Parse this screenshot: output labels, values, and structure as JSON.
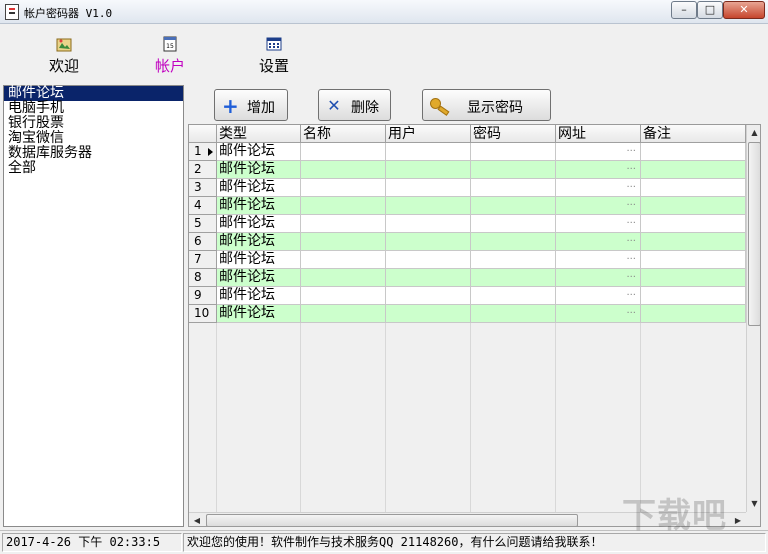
{
  "window": {
    "title": "帐户密码器 V1.0",
    "controls": {
      "minimize": "–",
      "maximize": "□",
      "close": "✕"
    }
  },
  "menu": [
    {
      "label": "欢迎",
      "icon": "welcome-icon"
    },
    {
      "label": "帐户",
      "icon": "calendar-icon"
    },
    {
      "label": "设置",
      "icon": "grid-icon"
    }
  ],
  "categories": [
    "邮件论坛",
    "电脑手机",
    "银行股票",
    "淘宝微信",
    "数据库服务器",
    "全部"
  ],
  "selected_category": "邮件论坛",
  "actions": {
    "add": "增加",
    "delete": "删除",
    "show_password": "显示密码"
  },
  "grid": {
    "columns": [
      "类型",
      "名称",
      "用户",
      "密码",
      "网址",
      "备注"
    ],
    "rows": [
      {
        "num": "1",
        "type": "邮件论坛"
      },
      {
        "num": "2",
        "type": "邮件论坛"
      },
      {
        "num": "3",
        "type": "邮件论坛"
      },
      {
        "num": "4",
        "type": "邮件论坛"
      },
      {
        "num": "5",
        "type": "邮件论坛"
      },
      {
        "num": "6",
        "type": "邮件论坛"
      },
      {
        "num": "7",
        "type": "邮件论坛"
      },
      {
        "num": "8",
        "type": "邮件论坛"
      },
      {
        "num": "9",
        "type": "邮件论坛"
      },
      {
        "num": "10",
        "type": "邮件论坛"
      }
    ],
    "url_ellipsis": "···"
  },
  "status": {
    "datetime": "2017-4-26 下午 02:33:5",
    "message": "欢迎您的使用！软件制作与技术服务QQ 21148260，有什么问题请给我联系！"
  },
  "watermark": "下载吧"
}
